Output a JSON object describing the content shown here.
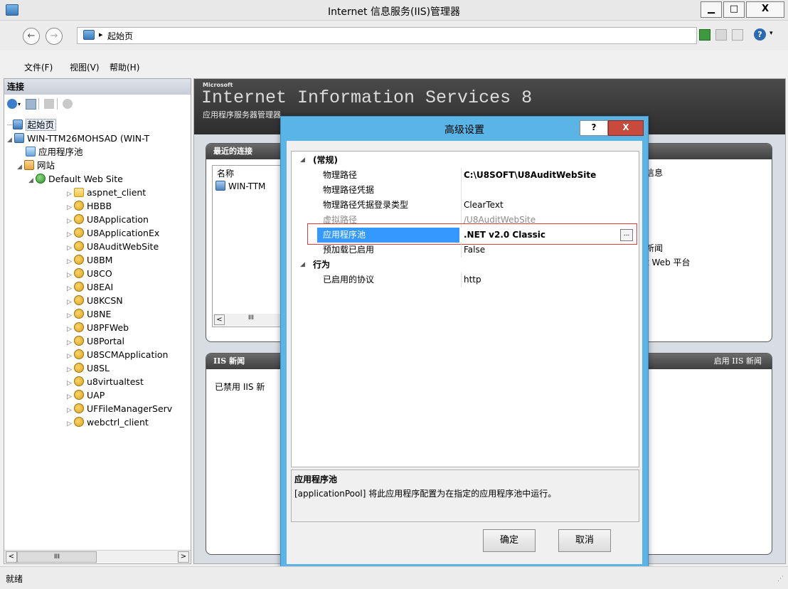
{
  "window": {
    "title": "Internet 信息服务(IIS)管理器",
    "minimize_label": "▁",
    "maximize_label": "□",
    "close_label": "X"
  },
  "nav": {
    "back": "←",
    "forward": "→",
    "address_sep": "▸",
    "address_text": "起始页",
    "help_label": "?"
  },
  "menu": {
    "file": "文件(F)",
    "view": "视图(V)",
    "help": "帮助(H)"
  },
  "connections": {
    "header": "连接",
    "tree": [
      {
        "label": "起始页",
        "icon": "start-page-icon"
      },
      {
        "label": "WIN-TTM26MOHSAD (WIN-T",
        "icon": "server-icon"
      },
      {
        "label": "应用程序池",
        "icon": "app-pool-icon"
      },
      {
        "label": "网站",
        "icon": "sites-folder-icon"
      },
      {
        "label": "Default Web Site",
        "icon": "globe-icon"
      },
      {
        "label": "aspnet_client",
        "icon": "folder-icon"
      },
      {
        "label": "HBBB",
        "icon": "application-icon"
      },
      {
        "label": "U8Application",
        "icon": "application-icon"
      },
      {
        "label": "U8ApplicationEx",
        "icon": "application-icon"
      },
      {
        "label": "U8AuditWebSite",
        "icon": "application-icon"
      },
      {
        "label": "U8BM",
        "icon": "application-icon"
      },
      {
        "label": "U8CO",
        "icon": "application-icon"
      },
      {
        "label": "U8EAI",
        "icon": "application-icon"
      },
      {
        "label": "U8KCSN",
        "icon": "application-icon"
      },
      {
        "label": "U8NE",
        "icon": "application-icon"
      },
      {
        "label": "U8PFWeb",
        "icon": "application-icon"
      },
      {
        "label": "U8Portal",
        "icon": "application-icon"
      },
      {
        "label": "U8SCMApplication",
        "icon": "application-icon"
      },
      {
        "label": "U8SL",
        "icon": "application-icon"
      },
      {
        "label": "u8virtualtest",
        "icon": "application-icon"
      },
      {
        "label": "UAP",
        "icon": "application-icon"
      },
      {
        "label": "UFFileManagerServ",
        "icon": "application-icon"
      },
      {
        "label": "webctrl_client",
        "icon": "application-icon"
      }
    ],
    "hscroll_thumb": "III"
  },
  "banner": {
    "microsoft": "Microsoft",
    "product": "Internet Information Services 8",
    "subtitle": "应用程序服务器管理器"
  },
  "recent": {
    "header": "最近的连接",
    "col_name": "名称",
    "row1": "WIN-TTM",
    "hscroll_thumb": "III"
  },
  "right_snippets": {
    "info": "信息",
    "news": "新闻",
    "web_platform": "t Web 平台"
  },
  "iis_news": {
    "header": "IIS 新闻",
    "enable": "启用 IIS 新闻",
    "disabled": "已禁用 IIS 新"
  },
  "dialog": {
    "title": "高级设置",
    "help": "?",
    "close": "X",
    "groups": [
      {
        "name": "(常规)",
        "rows": [
          {
            "name": "物理路径",
            "value": "C:\\U8SOFT\\U8AuditWebSite",
            "bold": true
          },
          {
            "name": "物理路径凭据",
            "value": ""
          },
          {
            "name": "物理路径凭据登录类型",
            "value": "ClearText"
          },
          {
            "name": "虚拟路径",
            "value": "/U8AuditWebSite",
            "greyed": true
          },
          {
            "name": "应用程序池",
            "value": ".NET v2.0 Classic",
            "bold": true,
            "selected": true
          },
          {
            "name": "预加载已启用",
            "value": "False"
          }
        ]
      },
      {
        "name": "行为",
        "rows": [
          {
            "name": "已启用的协议",
            "value": "http"
          }
        ]
      }
    ],
    "ellipsis": "...",
    "desc_title": "应用程序池",
    "desc_text": "[applicationPool] 将此应用程序配置为在指定的应用程序池中运行。",
    "ok": "确定",
    "cancel": "取消",
    "highlight_color": "#e03a3a",
    "selection_color": "#3399ff"
  },
  "status": {
    "text": "就绪"
  }
}
